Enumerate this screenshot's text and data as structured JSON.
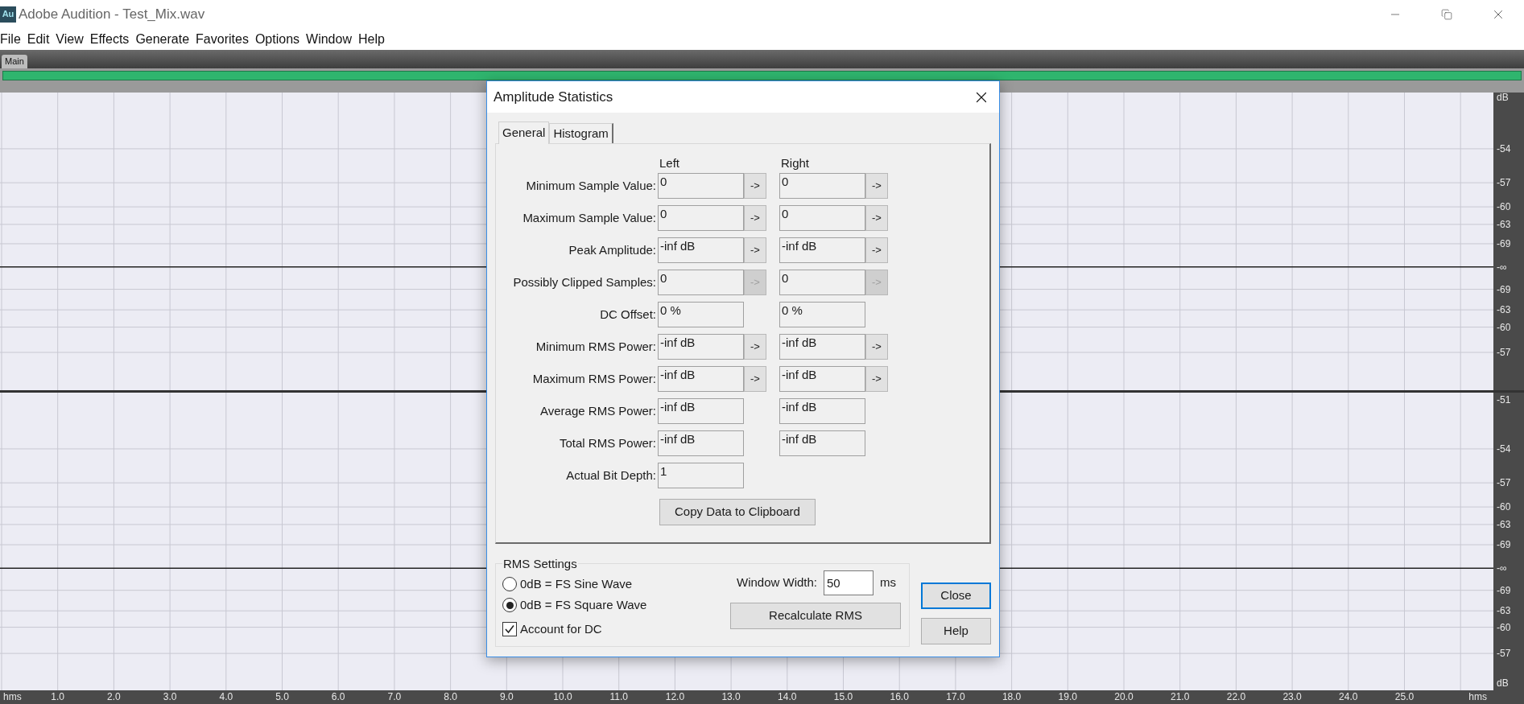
{
  "window": {
    "app_icon": "Au",
    "title": "Adobe Audition - Test_Mix.wav"
  },
  "menu": [
    "File",
    "Edit",
    "View",
    "Effects",
    "Generate",
    "Favorites",
    "Options",
    "Window",
    "Help"
  ],
  "panel_tab": "Main",
  "waveform": {
    "channels": [
      {
        "scale": [
          "dB",
          "-54",
          "-57",
          "-60",
          "-63",
          "-69",
          "-∞",
          "-69",
          "-63",
          "-60",
          "-57"
        ]
      },
      {
        "scale": [
          "-51",
          "-54",
          "-57",
          "-60",
          "-63",
          "-69",
          "-∞",
          "-69",
          "-63",
          "-60",
          "-57",
          "dB"
        ]
      }
    ],
    "time_ruler": [
      "1.0",
      "2.0",
      "3.0",
      "4.0",
      "5.0",
      "6.0",
      "7.0",
      "8.0",
      "9.0",
      "10.0",
      "11.0",
      "12.0",
      "13.0",
      "14.0",
      "15.0",
      "16.0",
      "17.0",
      "18.0",
      "19.0",
      "20.0",
      "21.0",
      "22.0",
      "23.0",
      "24.0",
      "25.0"
    ],
    "ruler_unit_left": "hms",
    "ruler_unit_right": "hms"
  },
  "dialog": {
    "title": "Amplitude Statistics",
    "tabs": [
      {
        "label": "General",
        "selected": true
      },
      {
        "label": "Histogram",
        "selected": false
      }
    ],
    "columns": [
      "Left",
      "Right"
    ],
    "rows": [
      {
        "label": "Minimum Sample Value:",
        "cells": [
          {
            "value": "0",
            "arrow": "->",
            "disabled": false
          },
          {
            "value": "0",
            "arrow": "->",
            "disabled": false
          }
        ]
      },
      {
        "label": "Maximum Sample Value:",
        "cells": [
          {
            "value": "0",
            "arrow": "->",
            "disabled": false
          },
          {
            "value": "0",
            "arrow": "->",
            "disabled": false
          }
        ]
      },
      {
        "label": "Peak Amplitude:",
        "cells": [
          {
            "value": "-inf dB",
            "arrow": "->",
            "disabled": false
          },
          {
            "value": "-inf dB",
            "arrow": "->",
            "disabled": false
          }
        ]
      },
      {
        "label": "Possibly Clipped Samples:",
        "cells": [
          {
            "value": "0",
            "arrow": "->",
            "disabled": true
          },
          {
            "value": "0",
            "arrow": "->",
            "disabled": true
          }
        ]
      },
      {
        "label": "DC Offset:",
        "cells": [
          {
            "value": "0 %"
          },
          {
            "value": "0 %"
          }
        ]
      },
      {
        "label": "Minimum RMS Power:",
        "cells": [
          {
            "value": "-inf dB",
            "arrow": "->",
            "disabled": false
          },
          {
            "value": "-inf dB",
            "arrow": "->",
            "disabled": false
          }
        ]
      },
      {
        "label": "Maximum RMS Power:",
        "cells": [
          {
            "value": "-inf dB",
            "arrow": "->",
            "disabled": false
          },
          {
            "value": "-inf dB",
            "arrow": "->",
            "disabled": false
          }
        ]
      },
      {
        "label": "Average RMS Power:",
        "cells": [
          {
            "value": "-inf dB"
          },
          {
            "value": "-inf dB"
          }
        ]
      },
      {
        "label": "Total RMS Power:",
        "cells": [
          {
            "value": "-inf dB"
          },
          {
            "value": "-inf dB"
          }
        ]
      },
      {
        "label": "Actual Bit Depth:",
        "cells": [
          {
            "value": "1"
          }
        ]
      }
    ],
    "copy_button": "Copy Data to Clipboard",
    "rms_settings": {
      "title": "RMS Settings",
      "options": [
        {
          "label": "0dB = FS Sine Wave",
          "selected": false
        },
        {
          "label": "0dB = FS Square Wave",
          "selected": true
        }
      ],
      "account_for_dc": {
        "label": "Account for DC",
        "checked": true
      },
      "window_width": {
        "label": "Window Width:",
        "value": "50",
        "unit": "ms"
      },
      "recalculate_button": "Recalculate RMS"
    },
    "buttons": [
      {
        "label": "Close",
        "default": true
      },
      {
        "label": "Help",
        "default": false
      }
    ]
  }
}
